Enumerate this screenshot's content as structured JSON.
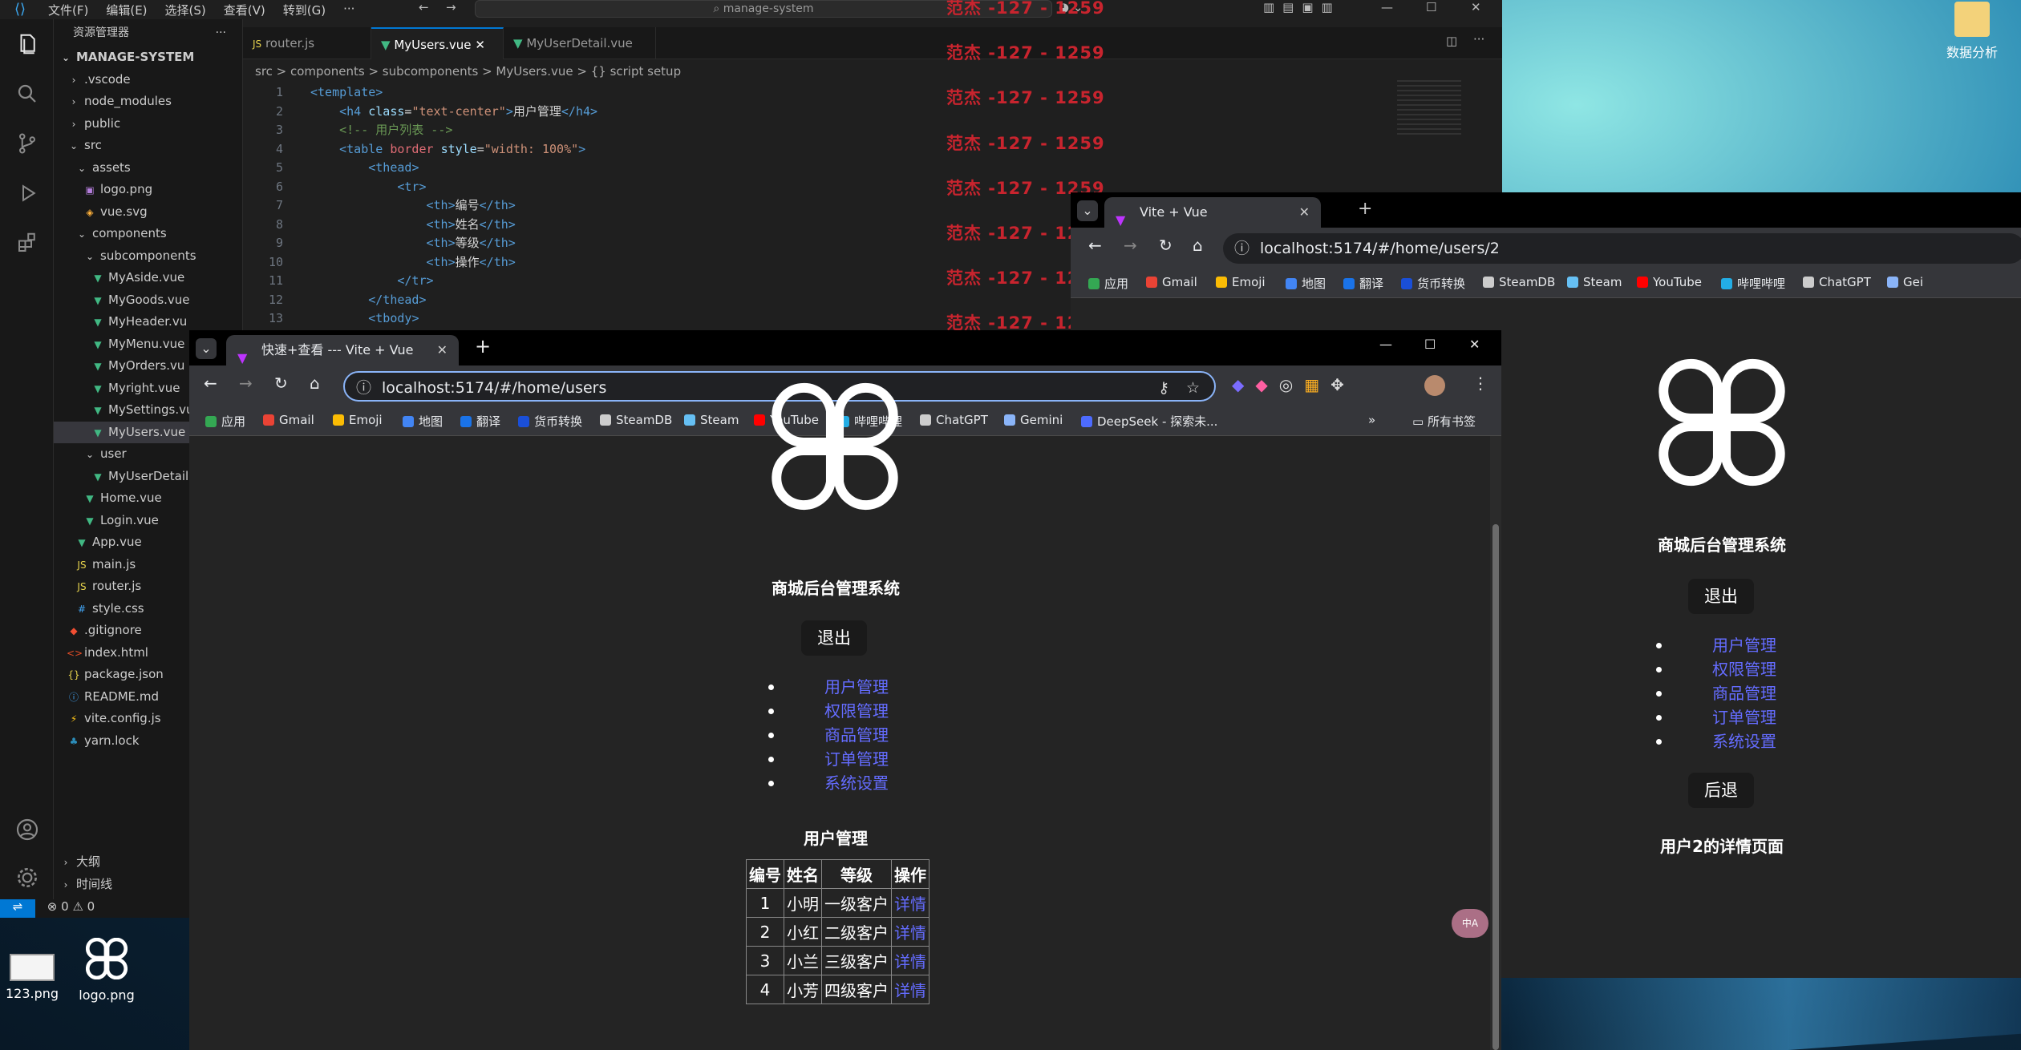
{
  "vscode": {
    "menu": [
      "文件(F)",
      "编辑(E)",
      "选择(S)",
      "查看(V)",
      "转到(G)",
      "···"
    ],
    "search_text": "manage-system",
    "explorer_title": "资源管理器",
    "project": "MANAGE-SYSTEM",
    "tree": [
      {
        "label": ".vscode",
        "indent": 1,
        "icon": "chevron-right",
        "sel": false
      },
      {
        "label": "node_modules",
        "indent": 1,
        "icon": "chevron-right",
        "sel": false
      },
      {
        "label": "public",
        "indent": 1,
        "icon": "chevron-right",
        "sel": false
      },
      {
        "label": "src",
        "indent": 1,
        "icon": "chevron-down",
        "sel": false
      },
      {
        "label": "assets",
        "indent": 2,
        "icon": "chevron-down",
        "sel": false
      },
      {
        "label": "logo.png",
        "indent": 3,
        "icon": "image",
        "sel": false
      },
      {
        "label": "vue.svg",
        "indent": 3,
        "icon": "svg",
        "sel": false
      },
      {
        "label": "components",
        "indent": 2,
        "icon": "chevron-down",
        "sel": false
      },
      {
        "label": "subcomponents",
        "indent": 3,
        "icon": "chevron-down",
        "sel": false
      },
      {
        "label": "MyAside.vue",
        "indent": 4,
        "icon": "vue",
        "sel": false
      },
      {
        "label": "MyGoods.vue",
        "indent": 4,
        "icon": "vue",
        "sel": false
      },
      {
        "label": "MyHeader.vu",
        "indent": 4,
        "icon": "vue",
        "sel": false
      },
      {
        "label": "MyMenu.vue",
        "indent": 4,
        "icon": "vue",
        "sel": false
      },
      {
        "label": "MyOrders.vu",
        "indent": 4,
        "icon": "vue",
        "sel": false
      },
      {
        "label": "Myright.vue",
        "indent": 4,
        "icon": "vue",
        "sel": false
      },
      {
        "label": "MySettings.vu",
        "indent": 4,
        "icon": "vue",
        "sel": false
      },
      {
        "label": "MyUsers.vue",
        "indent": 4,
        "icon": "vue",
        "sel": true
      },
      {
        "label": "user",
        "indent": 3,
        "icon": "chevron-down",
        "sel": false
      },
      {
        "label": "MyUserDetail",
        "indent": 4,
        "icon": "vue",
        "sel": false
      },
      {
        "label": "Home.vue",
        "indent": 3,
        "icon": "vue",
        "sel": false
      },
      {
        "label": "Login.vue",
        "indent": 3,
        "icon": "vue",
        "sel": false
      },
      {
        "label": "App.vue",
        "indent": 2,
        "icon": "vue",
        "sel": false
      },
      {
        "label": "main.js",
        "indent": 2,
        "icon": "js",
        "sel": false
      },
      {
        "label": "router.js",
        "indent": 2,
        "icon": "js",
        "sel": false
      },
      {
        "label": "style.css",
        "indent": 2,
        "icon": "css",
        "sel": false
      },
      {
        "label": ".gitignore",
        "indent": 1,
        "icon": "git",
        "sel": false
      },
      {
        "label": "index.html",
        "indent": 1,
        "icon": "html",
        "sel": false
      },
      {
        "label": "package.json",
        "indent": 1,
        "icon": "json",
        "sel": false
      },
      {
        "label": "README.md",
        "indent": 1,
        "icon": "info",
        "sel": false
      },
      {
        "label": "vite.config.js",
        "indent": 1,
        "icon": "vite",
        "sel": false
      },
      {
        "label": "yarn.lock",
        "indent": 1,
        "icon": "yarn",
        "sel": false
      }
    ],
    "outline_label": "大纲",
    "timeline_label": "时间线",
    "status_errors": "0",
    "status_warnings": "0",
    "tabs": [
      {
        "label": "router.js",
        "icon": "JS",
        "active": false
      },
      {
        "label": "MyUsers.vue",
        "icon": "vue",
        "active": true
      },
      {
        "label": "MyUserDetail.vue",
        "icon": "vue",
        "active": false
      }
    ],
    "breadcrumb": "src  >  components  >  subcomponents  >  MyUsers.vue  >  {} script setup",
    "code_lines": [
      {
        "n": "1",
        "indent": 0,
        "t": "<template>"
      },
      {
        "n": "2",
        "indent": 1,
        "t": "<h4 class=\"text-center\">用户管理</h4>"
      },
      {
        "n": "3",
        "indent": 1,
        "t": "<!-- 用户列表 -->"
      },
      {
        "n": "4",
        "indent": 1,
        "t": "<table border style=\"width: 100%\">"
      },
      {
        "n": "5",
        "indent": 2,
        "t": "<thead>"
      },
      {
        "n": "6",
        "indent": 3,
        "t": "<tr>"
      },
      {
        "n": "7",
        "indent": 4,
        "t": "<th>编号</th>"
      },
      {
        "n": "8",
        "indent": 4,
        "t": "<th>姓名</th>"
      },
      {
        "n": "9",
        "indent": 4,
        "t": "<th>等级</th>"
      },
      {
        "n": "10",
        "indent": 4,
        "t": "<th>操作</th>"
      },
      {
        "n": "11",
        "indent": 3,
        "t": "</tr>"
      },
      {
        "n": "12",
        "indent": 2,
        "t": "</thead>"
      },
      {
        "n": "13",
        "indent": 2,
        "t": "<tbody>"
      }
    ]
  },
  "watermark_text": "范杰 -127 - 1259",
  "desktop": {
    "icons": [
      {
        "label": "数据分析"
      },
      {
        "label": "123.png"
      },
      {
        "label": "logo.png"
      }
    ]
  },
  "browser_back": {
    "tab_title": "Vite + Vue",
    "url": "localhost:5174/#/home/users/2",
    "bookmarks": [
      "应用",
      "Gmail",
      "Emoji",
      "地图",
      "翻译",
      "货币转换",
      "SteamDB",
      "Steam",
      "YouTube",
      "哔哩哔哩",
      "ChatGPT",
      "Gei"
    ],
    "app": {
      "title": "商城后台管理系统",
      "logout": "退出",
      "menu": [
        "用户管理",
        "权限管理",
        "商品管理",
        "订单管理",
        "系统设置"
      ],
      "back": "后退",
      "detail": "用户2的详情页面"
    }
  },
  "browser_front": {
    "tab_title": "快速+查看 --- Vite + Vue",
    "url": "localhost:5174/#/home/users",
    "bookmarks": [
      "应用",
      "Gmail",
      "Emoji",
      "地图",
      "翻译",
      "货币转换",
      "SteamDB",
      "Steam",
      "YouTube",
      "哔哩哔哩",
      "ChatGPT",
      "Gemini",
      "DeepSeek - 探索未..."
    ],
    "all_bookmarks": "所有书签",
    "app": {
      "title": "商城后台管理系统",
      "logout": "退出",
      "menu": [
        "用户管理",
        "权限管理",
        "商品管理",
        "订单管理",
        "系统设置"
      ],
      "section": "用户管理",
      "table": {
        "headers": [
          "编号",
          "姓名",
          "等级",
          "操作"
        ],
        "rows": [
          [
            "1",
            "小明",
            "一级客户",
            "详情"
          ],
          [
            "2",
            "小红",
            "二级客户",
            "详情"
          ],
          [
            "3",
            "小兰",
            "三级客户",
            "详情"
          ],
          [
            "4",
            "小芳",
            "四级客户",
            "详情"
          ]
        ]
      }
    }
  },
  "colors": {
    "vue_link": "#646cff",
    "watermark": "#c8242e",
    "vscode_accent": "#0078d4"
  }
}
